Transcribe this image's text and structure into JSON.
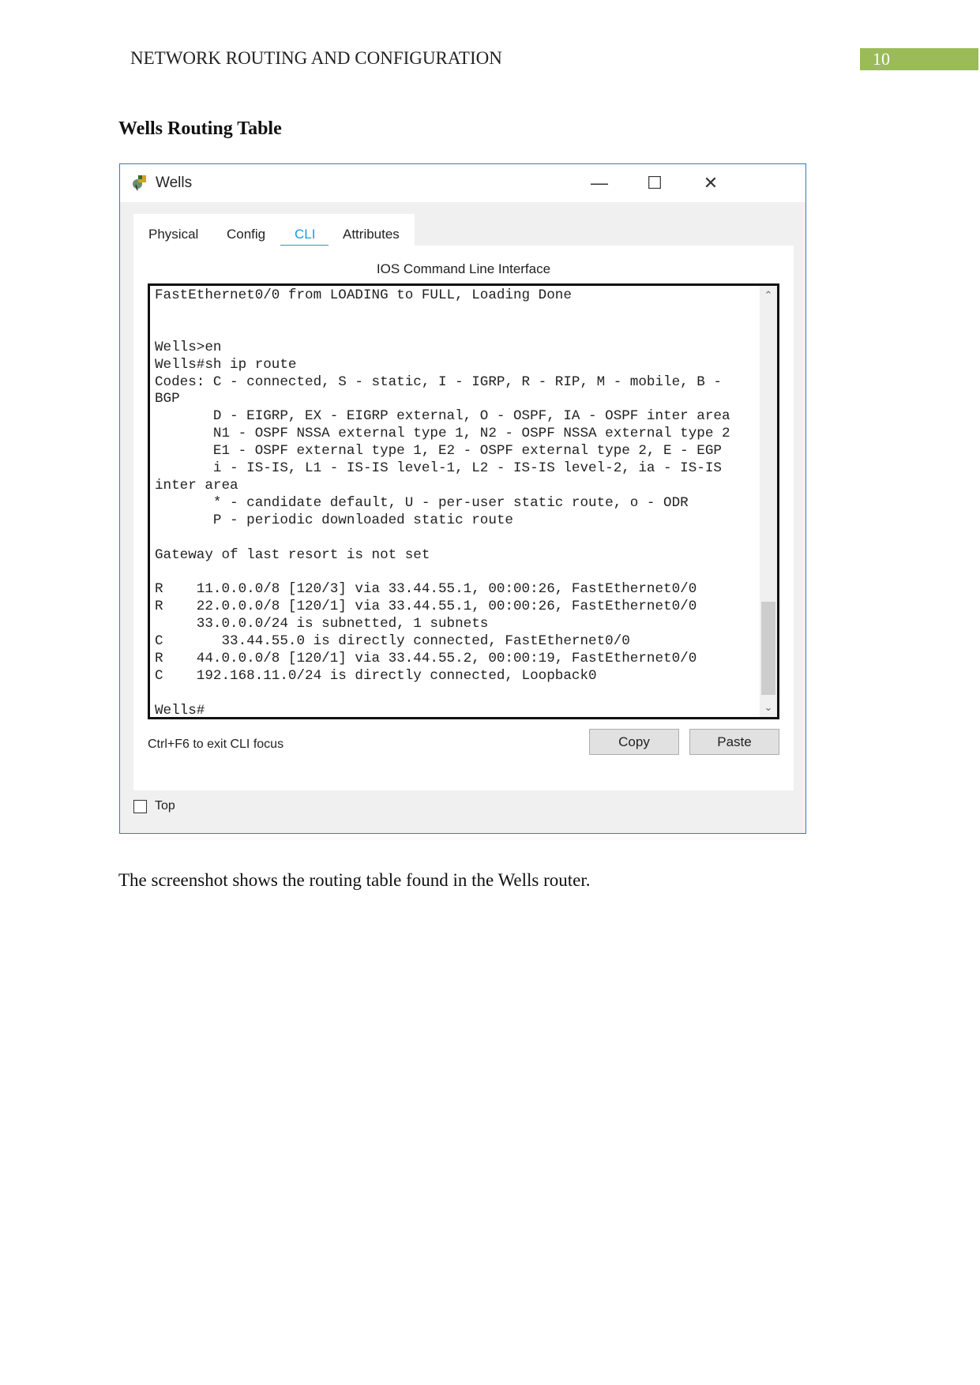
{
  "header": {
    "title": "NETWORK ROUTING AND CONFIGURATION",
    "page_number": "10",
    "accent_color": "#9bbb59"
  },
  "heading": "Wells Routing Table",
  "window": {
    "title": "Wells",
    "app_icon": "packet-tracer-router-icon",
    "controls": {
      "minimize": "—",
      "maximize": "☐",
      "close": "✕"
    },
    "tabs": [
      {
        "label": "Physical"
      },
      {
        "label": "Config"
      },
      {
        "label": "CLI",
        "active": true
      },
      {
        "label": "Attributes"
      }
    ],
    "cli_title": "IOS Command Line Interface",
    "terminal_lines": [
      "FastEthernet0/0 from LOADING to FULL, Loading Done",
      "",
      "",
      "Wells>en",
      "Wells#sh ip route",
      "Codes: C - connected, S - static, I - IGRP, R - RIP, M - mobile, B -",
      "BGP",
      "       D - EIGRP, EX - EIGRP external, O - OSPF, IA - OSPF inter area",
      "       N1 - OSPF NSSA external type 1, N2 - OSPF NSSA external type 2",
      "       E1 - OSPF external type 1, E2 - OSPF external type 2, E - EGP",
      "       i - IS-IS, L1 - IS-IS level-1, L2 - IS-IS level-2, ia - IS-IS",
      "inter area",
      "       * - candidate default, U - per-user static route, o - ODR",
      "       P - periodic downloaded static route",
      "",
      "Gateway of last resort is not set",
      "",
      "R    11.0.0.0/8 [120/3] via 33.44.55.1, 00:00:26, FastEthernet0/0",
      "R    22.0.0.0/8 [120/1] via 33.44.55.1, 00:00:26, FastEthernet0/0",
      "     33.0.0.0/24 is subnetted, 1 subnets",
      "C       33.44.55.0 is directly connected, FastEthernet0/0",
      "R    44.0.0.0/8 [120/1] via 33.44.55.2, 00:00:19, FastEthernet0/0",
      "C    192.168.11.0/24 is directly connected, Loopback0",
      "",
      "Wells#"
    ],
    "hint": "Ctrl+F6 to exit CLI focus",
    "copy_label": "Copy",
    "paste_label": "Paste",
    "top_label": "Top",
    "top_checked": false,
    "tab_accent": "#1a9bd7"
  },
  "caption": "The screenshot shows the routing table found in the Wells router."
}
